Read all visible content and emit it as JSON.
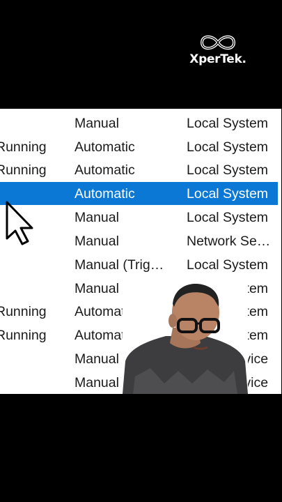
{
  "logo": {
    "text": "XperTek."
  },
  "table": {
    "rows": [
      {
        "status": "",
        "startup": "Manual",
        "logon": "Local System",
        "selected": false
      },
      {
        "status": "Running",
        "startup": "Automatic",
        "logon": "Local System",
        "selected": false
      },
      {
        "status": "Running",
        "startup": "Automatic",
        "logon": "Local System",
        "selected": false
      },
      {
        "status": "",
        "startup": "Automatic",
        "logon": "Local System",
        "selected": true
      },
      {
        "status": "",
        "startup": "Manual",
        "logon": "Local System",
        "selected": false
      },
      {
        "status": "",
        "startup": "Manual",
        "logon": "Network Se…",
        "selected": false
      },
      {
        "status": "",
        "startup": "Manual (Trig…",
        "logon": "Local System",
        "selected": false
      },
      {
        "status": "",
        "startup": "Manual",
        "logon": "Local System",
        "selected": false
      },
      {
        "status": "Running",
        "startup": "Automatic",
        "logon": "Local System",
        "selected": false
      },
      {
        "status": "Running",
        "startup": "Automatic",
        "logon": "Local System",
        "selected": false
      },
      {
        "status": "",
        "startup": "Manual",
        "logon": "Local Service",
        "selected": false
      },
      {
        "status": "",
        "startup": "Manual",
        "logon": "Local Service",
        "selected": false
      }
    ]
  },
  "colors": {
    "selection": "#0a78d4",
    "text": "#1a1a1a"
  },
  "icons": {
    "cursor": "arrow-pointer-icon",
    "logo": "infinity-icon"
  }
}
